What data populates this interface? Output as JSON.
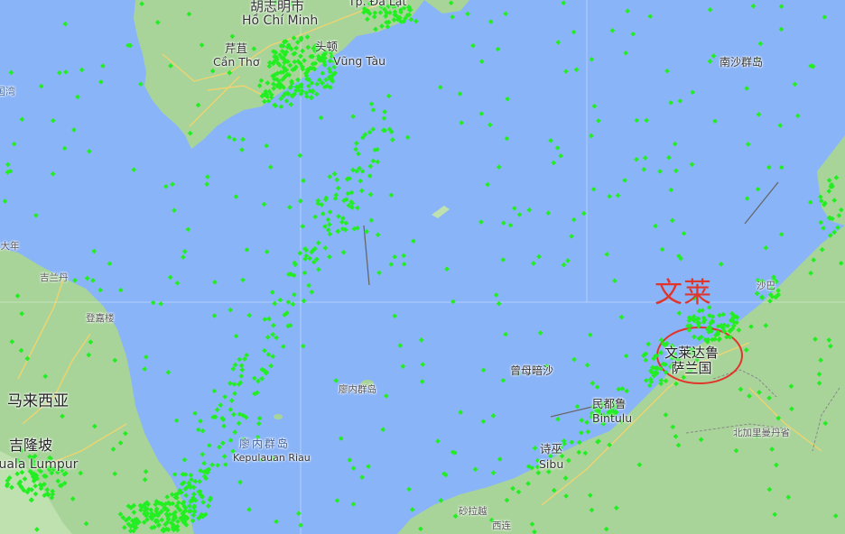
{
  "map": {
    "colors": {
      "water": "#8ab4f8",
      "land": "#a8d49a",
      "land_light": "#bfe0af",
      "road": "#f6d36b",
      "ship": "#22ee22",
      "annotation": "#e0352b"
    },
    "labels": {
      "hcmc_cn": "胡志明市",
      "hcmc": "Hồ Chí Minh",
      "dalat": "Tp. Đà Lạt",
      "cantho_cn": "芹苴",
      "cantho": "Cần Thơ",
      "vungtau_cn": "头顿",
      "vungtau": "Vũng Tàu",
      "nansha": "南沙群岛",
      "gulf_fragment": "泰国湾",
      "nanyang_fragment": "北大年",
      "kelantan_fragment": "吉兰丹",
      "terengganu_fragment": "登嘉楼",
      "malaysia": "马来西亚",
      "kl_cn": "吉隆坡",
      "kl": "Kuala Lumpur",
      "natuna_cn": "廖内群岛",
      "riau_cn": "廖内群岛",
      "riau": "Kepulauan Riau",
      "zengmu": "曾母暗沙",
      "bintulu_cn": "民都鲁",
      "bintulu": "Bintulu",
      "sibu_cn": "诗巫",
      "sibu": "Sibu",
      "sabah_fragment": "沙巴",
      "kalimantan_utara": "北加里曼丹省",
      "sarikei_fragment": "砂拉越",
      "xilian_fragment": "西连",
      "brunei_line1": "文莱达鲁",
      "brunei_line2": "萨兰国",
      "annotation": "文莱"
    }
  }
}
